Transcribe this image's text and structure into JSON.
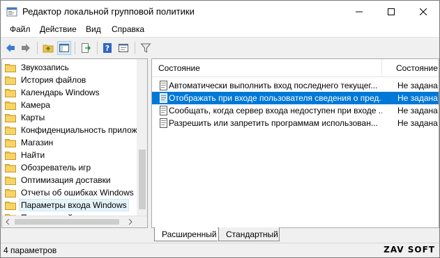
{
  "window": {
    "title": "Редактор локальной групповой политики"
  },
  "menu": {
    "items": [
      "Файл",
      "Действие",
      "Вид",
      "Справка"
    ]
  },
  "tree": {
    "items": [
      {
        "label": "Звукозапись"
      },
      {
        "label": "История файлов"
      },
      {
        "label": "Календарь Windows"
      },
      {
        "label": "Камера"
      },
      {
        "label": "Карты"
      },
      {
        "label": "Конфиденциальность прилож"
      },
      {
        "label": "Магазин"
      },
      {
        "label": "Найти"
      },
      {
        "label": "Обозреватель игр"
      },
      {
        "label": "Оптимизация доставки"
      },
      {
        "label": "Отчеты об ошибках Windows"
      },
      {
        "label": "Параметры входа Windows",
        "selected": true
      },
      {
        "label": "Поиск устройства"
      }
    ]
  },
  "list": {
    "columns": [
      "Состояние",
      "Состояние"
    ],
    "rows": [
      {
        "name": "Автоматически выполнить вход последнего текущег...",
        "state": "Не задана"
      },
      {
        "name": "Отображать при входе пользователя сведения о пред...",
        "state": "Не задана",
        "selected": true
      },
      {
        "name": "Сообщать, когда сервер входа недоступен при входе ...",
        "state": "Не задана"
      },
      {
        "name": "Разрешить или запретить программам использован...",
        "state": "Не задана"
      }
    ]
  },
  "tabs": [
    "Расширенный",
    "Стандартный"
  ],
  "status": {
    "text": "4 параметров",
    "watermark": "ZAV SOFT"
  },
  "colors": {
    "selection": "#0078d7",
    "folder": "#f0c043"
  }
}
